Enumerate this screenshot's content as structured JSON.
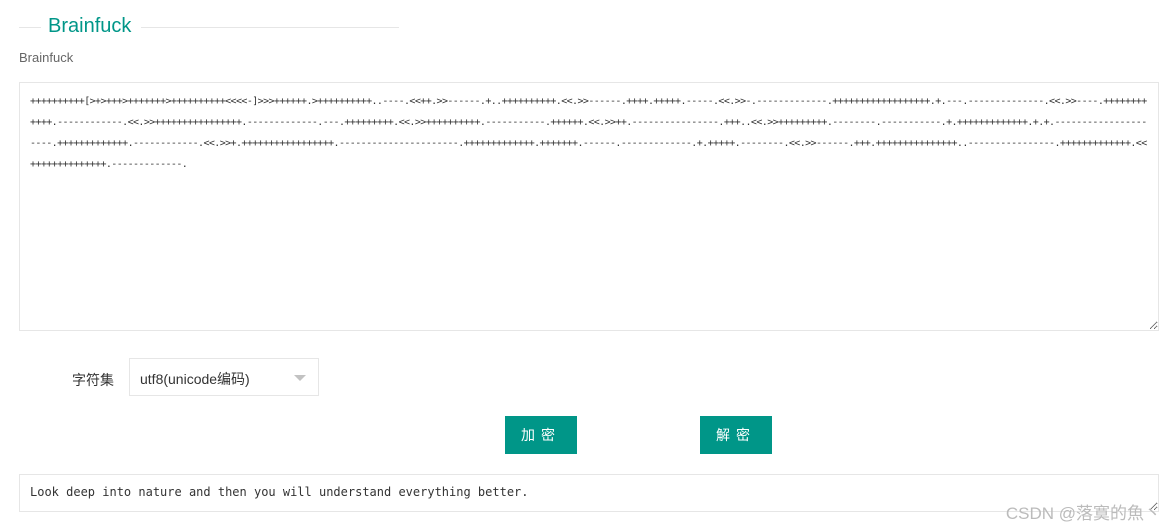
{
  "section": {
    "title": "Brainfuck",
    "subtitle": "Brainfuck"
  },
  "input": {
    "value": "++++++++++[>+>+++>+++++++>++++++++++<<<<-]>>>++++++.>++++++++++..----.<<++.>>------.+..++++++++++.<<.>>------.++++.+++++.-----.<<.>>-.-------------.++++++++++++++++++.+.---.--------------.<<.>>----.++++++++++++.------------.<<.>>++++++++++++++++.-------------.---.+++++++++.<<.>>++++++++++.-----------.++++++.<<.>>++.----------------.+++..<<.>>+++++++++.--------.-----------.+.+++++++++++++.+.+.---------------------.+++++++++++++.------------.<<.>>+.+++++++++++++++++.----------------------.+++++++++++++.+++++++.------.-------------.+.+++++.--------.<<.>>------.+++.+++++++++++++++..----------------.+++++++++++++.<<++++++++++++++.-------------."
  },
  "charset": {
    "label": "字符集",
    "selected": "utf8(unicode编码)"
  },
  "buttons": {
    "encrypt": "加密",
    "decrypt": "解密"
  },
  "output": {
    "value": "Look deep into nature and then you will understand everything better."
  },
  "watermark": "CSDN @落寞的魚丶",
  "colors": {
    "accent": "#009688"
  }
}
